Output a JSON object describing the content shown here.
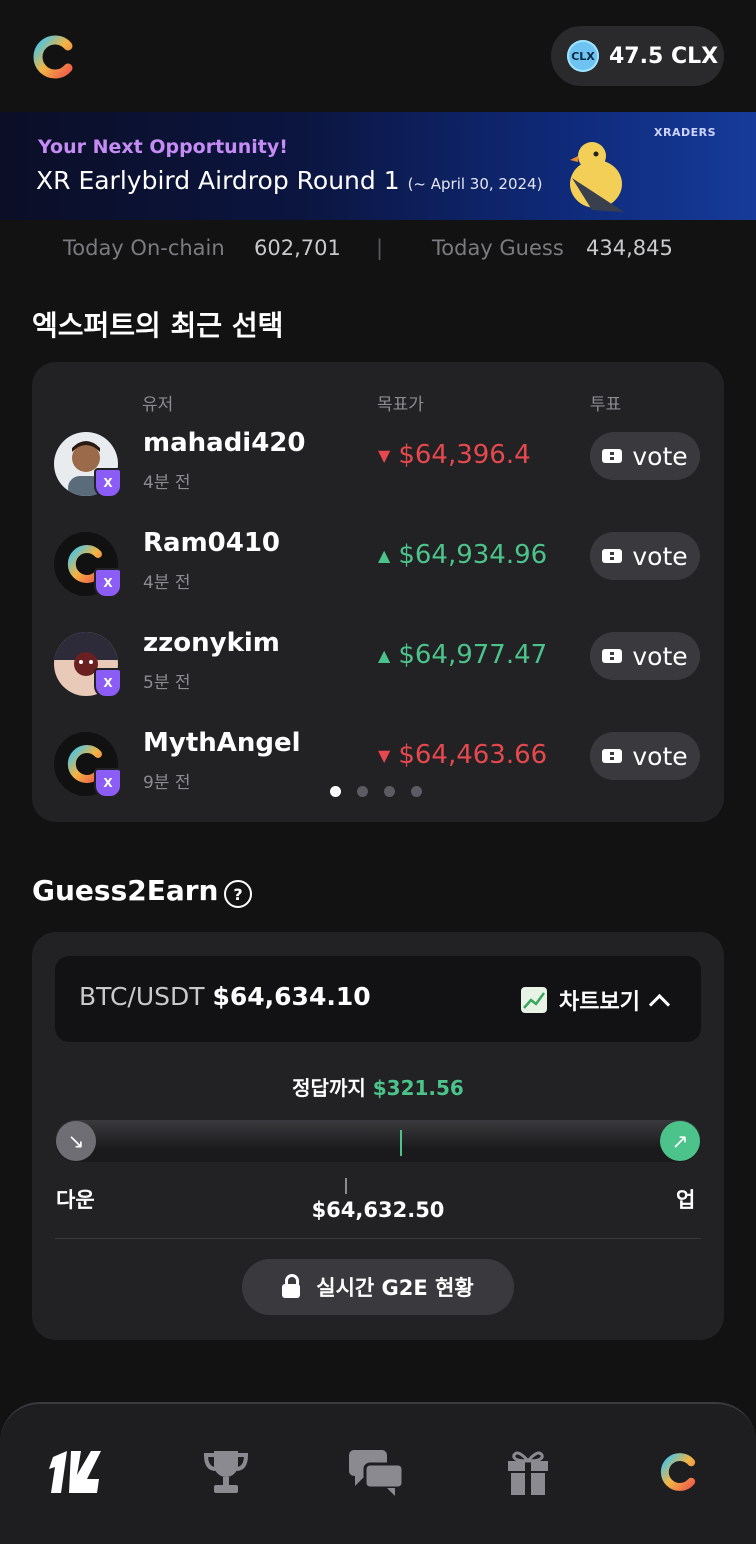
{
  "header": {
    "balance": "47.5 CLX",
    "currency_icon": "CLX"
  },
  "banner": {
    "subtitle": "Your Next Opportunity!",
    "title": "XR Earlybird Airdrop Round 1",
    "date": "(~ April 30, 2024)",
    "brand": "XRADERS"
  },
  "stats": {
    "onchain_label": "Today On-chain",
    "onchain_value": "602,701",
    "separator": "|",
    "guess_label": "Today Guess",
    "guess_value": "434,845"
  },
  "experts": {
    "title": "엑스퍼트의 최근 선택",
    "col_user": "유저",
    "col_target": "목표가",
    "col_vote": "투표",
    "rows": [
      {
        "name": "mahadi420",
        "time": "4분 전",
        "price": "$64,396.4",
        "direction": "down",
        "vote_label": "vote"
      },
      {
        "name": "Ram0410",
        "time": "4분 전",
        "price": "$64,934.96",
        "direction": "up",
        "vote_label": "vote"
      },
      {
        "name": "zzonykim",
        "time": "5분 전",
        "price": "$64,977.47",
        "direction": "up",
        "vote_label": "vote"
      },
      {
        "name": "MythAngel",
        "time": "9분 전",
        "price": "$64,463.66",
        "direction": "down",
        "vote_label": "vote"
      }
    ],
    "page_count": 4,
    "active_page": 1
  },
  "guess": {
    "title": "Guess2Earn",
    "pair": "BTC/USDT",
    "price": "$64,634.10",
    "chart_label": "차트보기",
    "to_answer_label": "정답까지",
    "to_answer_value": "$321.56",
    "down_label": "다운",
    "up_label": "업",
    "entry_price": "$64,632.50",
    "live_label": "실시간 G2E 현황"
  },
  "colors": {
    "up": "#4cc38a",
    "down": "#e5484d",
    "accent_purple": "#c58cf5"
  },
  "nav": [
    "home-icon",
    "trophy-icon",
    "chat-icon",
    "gift-icon",
    "profile-icon"
  ]
}
